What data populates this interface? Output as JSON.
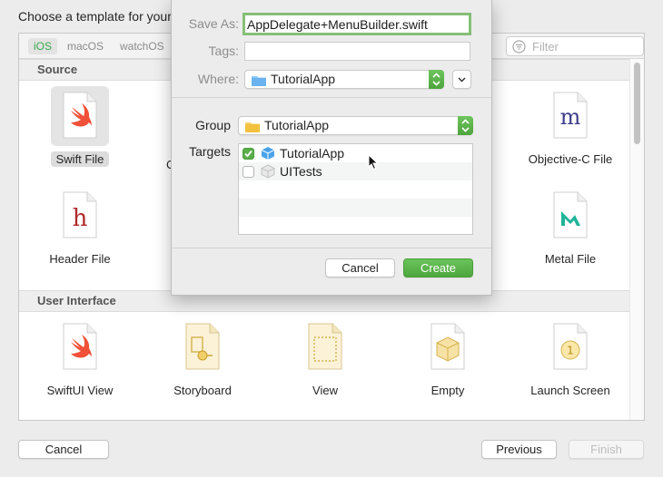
{
  "header": {
    "text": "Choose a template for your"
  },
  "platforms": [
    "iOS",
    "macOS",
    "watchOS"
  ],
  "filter": {
    "placeholder": "Filter"
  },
  "sections": {
    "source": "Source",
    "user_interface": "User Interface"
  },
  "source_templates": [
    "Swift File",
    "Objective-C File",
    "Header File",
    "Metal File"
  ],
  "ui_templates": [
    "SwiftUI View",
    "Storyboard",
    "View",
    "Empty",
    "Launch Screen"
  ],
  "partial_label": "C",
  "save_sheet": {
    "save_as_label": "Save As:",
    "save_as_value": "AppDelegate+MenuBuilder.swift",
    "tags_label": "Tags:",
    "where_label": "Where:",
    "where_value": "TutorialApp",
    "group_label": "Group",
    "group_value": "TutorialApp",
    "targets_label": "Targets",
    "targets": [
      {
        "label": "TutorialApp",
        "checked": true
      },
      {
        "label": "UITests",
        "checked": false
      }
    ],
    "cancel_label": "Cancel",
    "create_label": "Create"
  },
  "footer": {
    "cancel_label": "Cancel",
    "previous_label": "Previous",
    "finish_label": "Finish"
  },
  "colors": {
    "accent_green": "#5aae4a",
    "swift_orange": "#f05138",
    "header_h": "#b02a2a",
    "objc_m": "#3d3d8a",
    "metal_teal": "#1fb49a"
  }
}
